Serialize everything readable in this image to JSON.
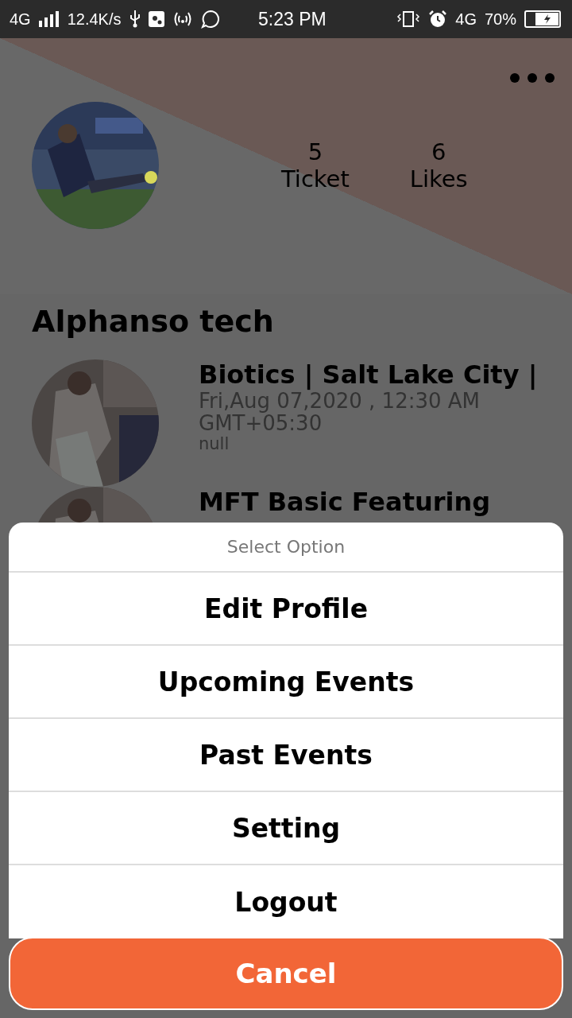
{
  "status_bar": {
    "network": "4G",
    "speed": "12.4K/s",
    "time": "5:23 PM",
    "network_right": "4G",
    "battery": "70%"
  },
  "profile": {
    "stats": [
      {
        "value": "5",
        "label": "Ticket"
      },
      {
        "value": "6",
        "label": "Likes"
      }
    ],
    "name": "Alphanso tech"
  },
  "events": [
    {
      "title": "Biotics | Salt Lake City |",
      "date": "Fri,Aug 07,2020 , 12:30 AM GMT+05:30",
      "note": "null"
    },
    {
      "title": "MFT Basic Featuring"
    }
  ],
  "sheet": {
    "title": "Select Option",
    "options": [
      "Edit Profile",
      "Upcoming Events",
      "Past Events",
      "Setting",
      "Logout"
    ],
    "cancel": "Cancel"
  }
}
